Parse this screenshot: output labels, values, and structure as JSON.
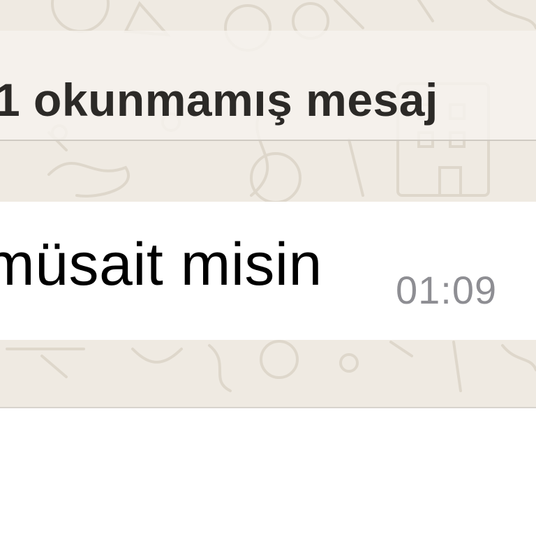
{
  "chat": {
    "unread_banner": "1 okunmamış mesaj",
    "message": {
      "text": "müsait misin",
      "time": "01:09"
    }
  },
  "colors": {
    "chat_background": "#efeae2",
    "bubble": "#ffffff",
    "banner_text": "#2c2a27",
    "time_text": "#8e8e93"
  }
}
